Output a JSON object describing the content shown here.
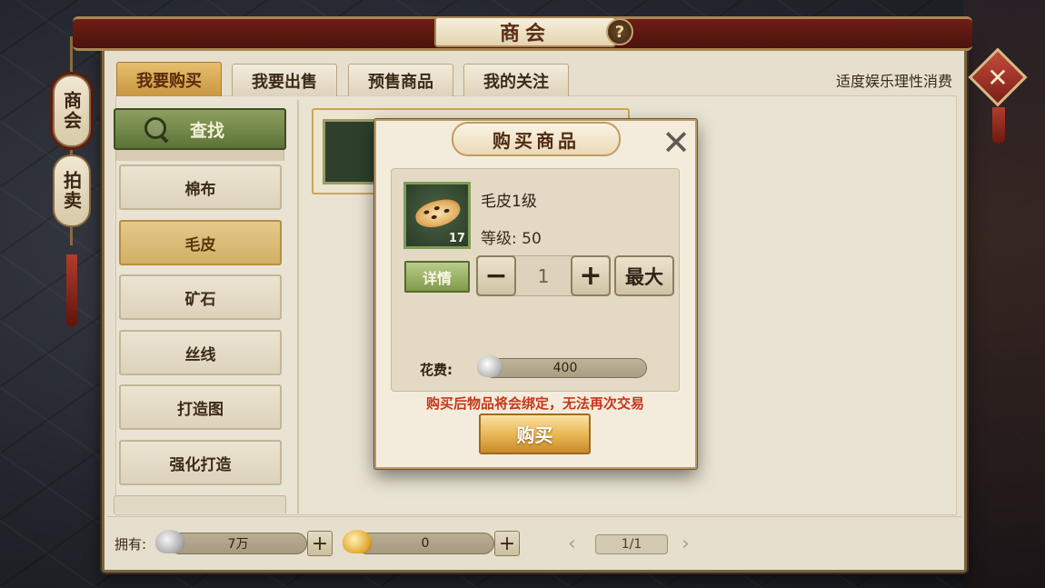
{
  "window": {
    "title": "商会",
    "help_icon": "question-icon",
    "close_icon": "close-x-icon",
    "tagline": "适度娱乐理性消费"
  },
  "side_tabs": [
    {
      "label": "商会",
      "active": true
    },
    {
      "label": "拍卖",
      "active": false
    }
  ],
  "tabs": [
    {
      "label": "我要购买",
      "active": true
    },
    {
      "label": "我要出售",
      "active": false
    },
    {
      "label": "预售商品",
      "active": false
    },
    {
      "label": "我的关注",
      "active": false
    }
  ],
  "search": {
    "label": "查找",
    "icon": "search-icon"
  },
  "categories": [
    {
      "label": "棉布",
      "active": false
    },
    {
      "label": "毛皮",
      "active": true
    },
    {
      "label": "矿石",
      "active": false
    },
    {
      "label": "丝线",
      "active": false
    },
    {
      "label": "打造图",
      "active": false
    },
    {
      "label": "强化打造",
      "active": false
    }
  ],
  "bottom": {
    "own_label": "拥有:",
    "silver_amount": "7万",
    "gold_amount": "0",
    "page_label": "1/1"
  },
  "modal": {
    "title": "购买商品",
    "item_name": "毛皮1级",
    "item_count": "17",
    "level_label": "等级:",
    "level_value": "50",
    "detail_label": "详情",
    "minus_label": "−",
    "quantity": "1",
    "plus_label": "+",
    "max_label": "最大",
    "cost_label": "花费:",
    "cost_value": "400",
    "warning": "购买后物品将会绑定，无法再次交易",
    "buy_label": "购买"
  },
  "colors": {
    "accent_gold": "#e7b553",
    "warning_red": "#c4381c",
    "search_green": "#6f8545",
    "title_red": "#5c1810"
  }
}
